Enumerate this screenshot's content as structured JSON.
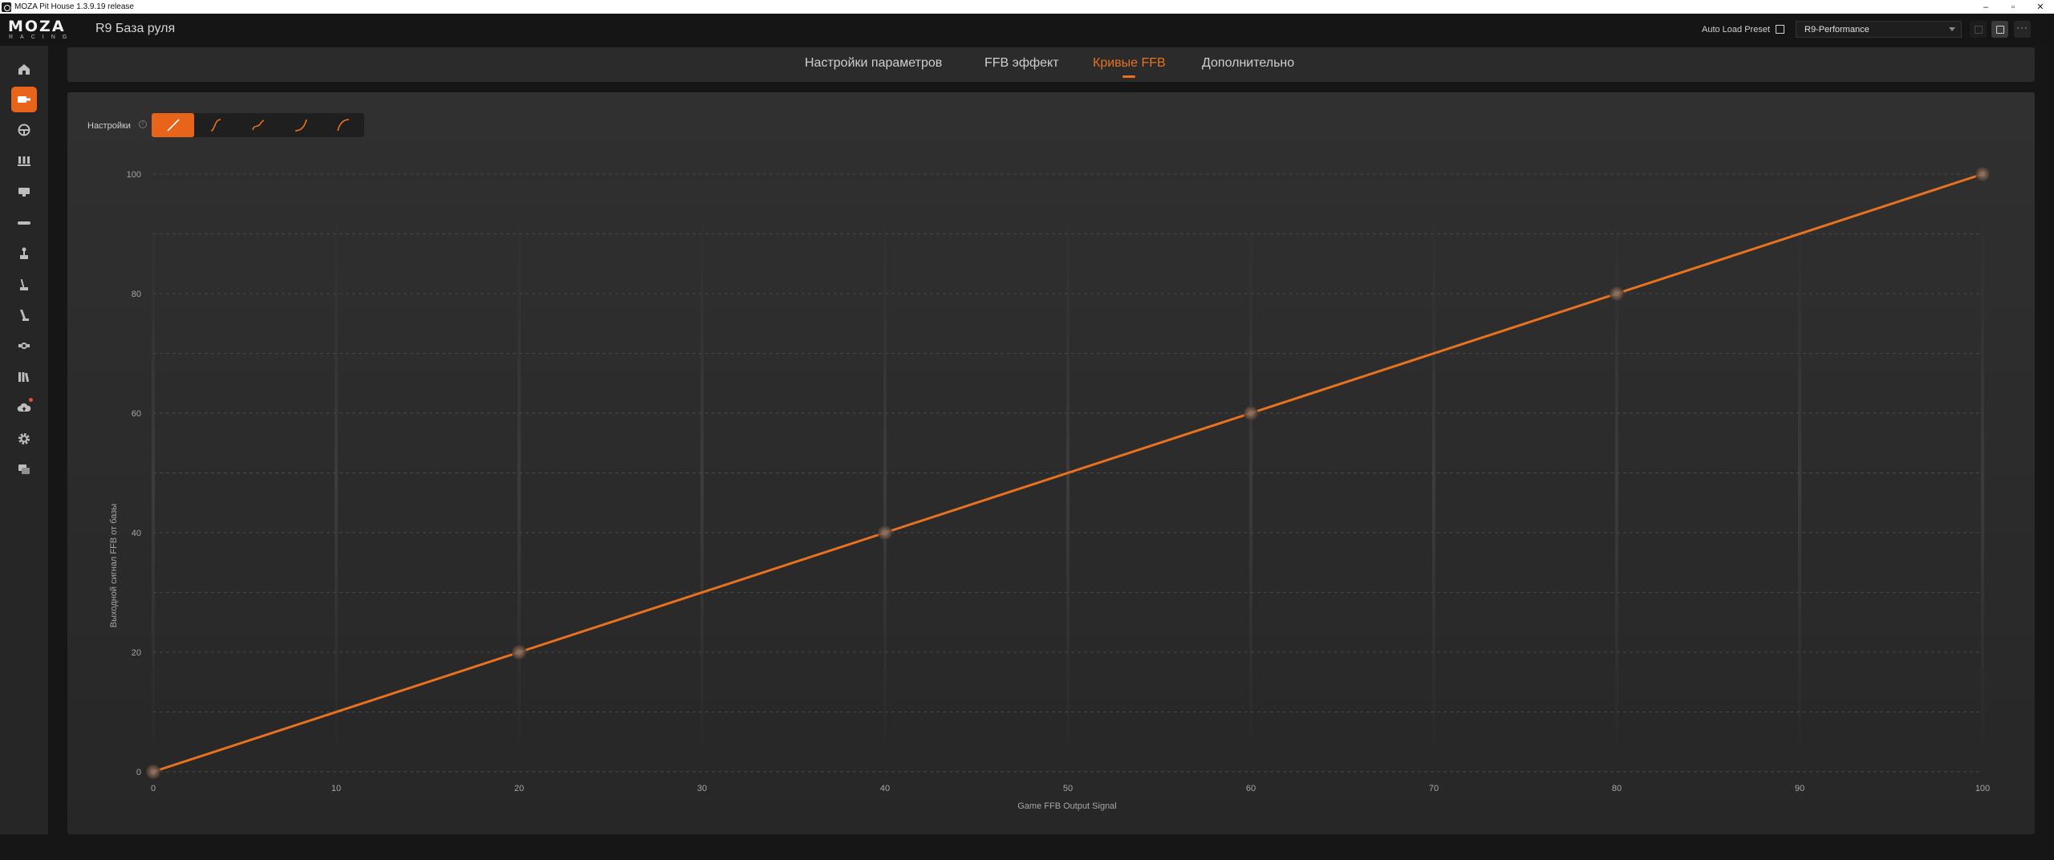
{
  "window": {
    "title": "MOZA Pit House 1.3.9.19 release",
    "controls": [
      "–",
      "▫",
      "✕"
    ]
  },
  "header": {
    "logo": "MOZA",
    "logo_sub": "RACING",
    "device_title": "R9 База руля",
    "auto_load_label": "Auto Load Preset",
    "auto_load_checked": false,
    "preset_value": "R9-Performance"
  },
  "sidebar": {
    "items": [
      {
        "icon": "home-icon",
        "active": false
      },
      {
        "icon": "wheelbase-icon",
        "active": true
      },
      {
        "icon": "steering-wheel-icon",
        "active": false
      },
      {
        "icon": "pedals-icon",
        "active": false
      },
      {
        "icon": "dashboard-icon",
        "active": false
      },
      {
        "icon": "handbrake-icon",
        "active": false
      },
      {
        "icon": "shifter-icon",
        "active": false
      },
      {
        "icon": "sequential-shifter-icon",
        "active": false
      },
      {
        "icon": "lever-icon",
        "active": false
      },
      {
        "icon": "accessory-icon",
        "active": false
      },
      {
        "icon": "library-icon",
        "active": false
      },
      {
        "icon": "cloud-update-icon",
        "active": false,
        "notification": true
      },
      {
        "icon": "settings-gear-icon",
        "active": false
      },
      {
        "icon": "support-chat-icon",
        "active": false
      }
    ]
  },
  "tabs": [
    {
      "label": "Настройки параметров",
      "active": false
    },
    {
      "label": "FFB эффект",
      "active": false
    },
    {
      "label": "Кривые FFB",
      "active": true
    },
    {
      "label": "Дополнительно",
      "active": false
    }
  ],
  "curve_settings": {
    "label": "Настройки",
    "presets": [
      "linear-curve-icon",
      "s-curve-icon",
      "wave-curve-icon",
      "exponential-curve-icon",
      "logarithmic-curve-icon"
    ],
    "selected_preset": 0
  },
  "colors": {
    "accent": "#e8641b",
    "curve": "#e8721f",
    "panel": "#2b2b2b",
    "background": "#161616"
  },
  "chart_data": {
    "type": "line",
    "xlabel": "Game FFB Output Signal",
    "ylabel": "Выходной сигнал FFB от базы",
    "xlim": [
      0,
      100
    ],
    "ylim": [
      0,
      100
    ],
    "x_ticks": [
      0,
      10,
      20,
      30,
      40,
      50,
      60,
      70,
      80,
      90,
      100
    ],
    "y_ticks": [
      0,
      20,
      40,
      60,
      80,
      100
    ],
    "grid": true,
    "series": [
      {
        "x": [
          0,
          20,
          40,
          60,
          80,
          100
        ],
        "y": [
          0,
          20,
          40,
          60,
          80,
          100
        ]
      }
    ],
    "control_points": [
      {
        "x": 0,
        "y": 0
      },
      {
        "x": 20,
        "y": 20
      },
      {
        "x": 40,
        "y": 40
      },
      {
        "x": 60,
        "y": 60
      },
      {
        "x": 80,
        "y": 80
      },
      {
        "x": 100,
        "y": 100
      }
    ]
  }
}
